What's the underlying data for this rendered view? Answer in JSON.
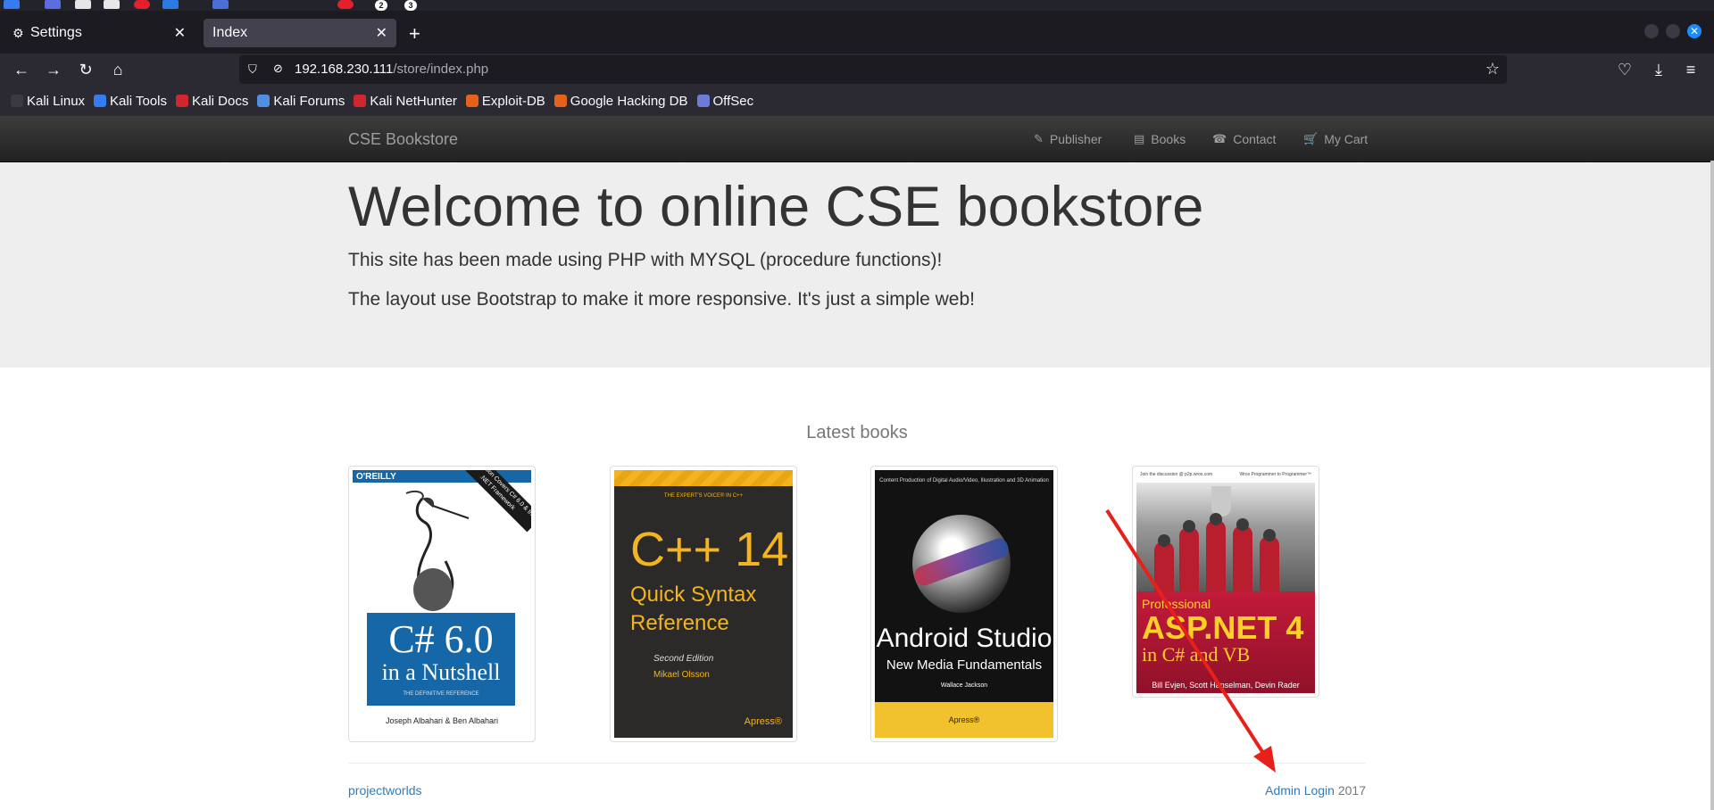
{
  "browser": {
    "tabs": [
      {
        "label": "Settings",
        "active": false
      },
      {
        "label": "Index",
        "active": true
      }
    ],
    "url_host": "192.168.230.111",
    "url_path": "/store/index.php",
    "bookmarks": [
      {
        "label": "Kali Linux",
        "color": "#2b2a33"
      },
      {
        "label": "Kali Tools",
        "color": "#367bf0"
      },
      {
        "label": "Kali Docs",
        "color": "#d0262f"
      },
      {
        "label": "Kali Forums",
        "color": "#4f8fe3"
      },
      {
        "label": "Kali NetHunter",
        "color": "#d0262f"
      },
      {
        "label": "Exploit-DB",
        "color": "#e5611c"
      },
      {
        "label": "Google Hacking DB",
        "color": "#e5611c"
      },
      {
        "label": "OffSec",
        "color": "#6c7bd8"
      }
    ]
  },
  "os": {
    "badges": [
      "2",
      "3"
    ]
  },
  "site": {
    "brand": "CSE Bookstore",
    "nav": [
      {
        "label": "Publisher",
        "icon": "paperclip-icon"
      },
      {
        "label": "Books",
        "icon": "book-icon"
      },
      {
        "label": "Contact",
        "icon": "phone-icon"
      },
      {
        "label": "My Cart",
        "icon": "cart-icon"
      }
    ],
    "jumbotron": {
      "title": "Welcome to online CSE bookstore",
      "line1": "This site has been made using PHP with MYSQL (procedure functions)!",
      "line2": "The layout use Bootstrap to make it more responsive. It's just a simple web!"
    },
    "latest_heading": "Latest books",
    "books": [
      {
        "publisher": "O'REILLY",
        "edition": "6th Edition\nCovers C# 6.0 & the .NET Framework",
        "title_line1": "C# 6.0",
        "title_line2": "in a Nutshell",
        "subtitle": "THE DEFINITIVE REFERENCE",
        "authors": "Joseph Albahari & Ben Albahari"
      },
      {
        "series": "THE EXPERT'S VOICE® IN C++",
        "title_line1": "C++ 14",
        "title_line2": "Quick Syntax",
        "title_line3": "Reference",
        "edition": "Second Edition",
        "authors": "Mikael Olsson",
        "publisher": "Apress®"
      },
      {
        "tagline": "Content Production of Digital Audio/Video, Illustration and 3D Animation",
        "title_line1": "Android Studio",
        "title_line2": "New Media Fundamentals",
        "authors": "Wallace Jackson",
        "publisher": "Apress®"
      },
      {
        "topline_left": "Join the discussion @ p2p.wrox.com",
        "topline_right": "Wrox Programmer to Programmer™",
        "prefix": "Professional",
        "title_line1": "ASP.NET 4",
        "title_line2": "in C# and VB",
        "authors": "Bill Evjen, Scott Hanselman, Devin Rader"
      }
    ],
    "footer": {
      "left_link": "projectworlds",
      "admin_link": "Admin Login",
      "year": "2017"
    }
  },
  "colors": {
    "link": "#337ab7",
    "annotation_arrow": "#e8201a",
    "navbar_bg": "#222222",
    "jumbotron_bg": "#eeeeee"
  }
}
